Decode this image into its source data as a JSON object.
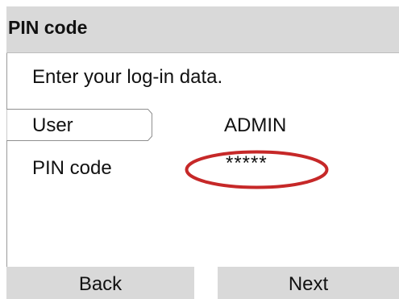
{
  "screen": {
    "title": "PIN code",
    "instruction": "Enter your log-in data."
  },
  "fields": {
    "user": {
      "label": "User",
      "value": "ADMIN"
    },
    "pin": {
      "label": "PIN code",
      "value": "*****"
    }
  },
  "footer": {
    "back_label": "Back",
    "next_label": "Next"
  },
  "colors": {
    "title_bar": "#d9d9d9",
    "button_background": "#d9d9d9",
    "highlight_oval": "#c62828",
    "text": "#111111"
  }
}
